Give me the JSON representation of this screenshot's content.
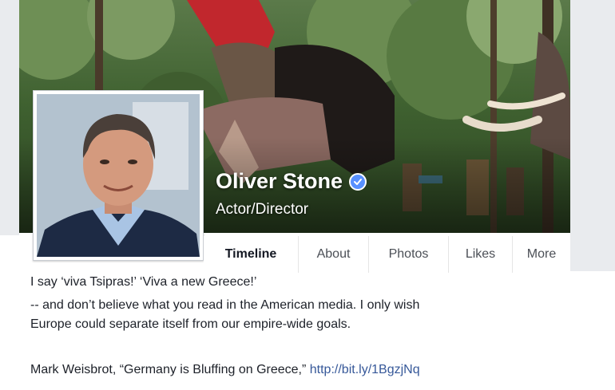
{
  "profile": {
    "name": "Oliver Stone",
    "role": "Actor/Director",
    "verified": true
  },
  "tabs": [
    {
      "label": "Timeline",
      "active": true
    },
    {
      "label": "About",
      "active": false
    },
    {
      "label": "Photos",
      "active": false
    },
    {
      "label": "Likes",
      "active": false
    },
    {
      "label": "More",
      "active": false
    }
  ],
  "post": {
    "line1": "I say ‘viva Tsipras!’ ‘Viva a new Greece!’",
    "line2a": "-- and don’t believe what you read in the American media. I only wish",
    "line2b": "Europe could separate itself from our empire-wide goals.",
    "line3_text": "Mark Weisbrot, “Germany is Bluffing on Greece,”",
    "line3_link": "http://bit.ly/1BgzjNq"
  },
  "colors": {
    "link": "#365899",
    "verified_badge": "#5890ff",
    "page_background": "#e9ebee"
  },
  "icons": {
    "verified": "verified-check-icon"
  }
}
